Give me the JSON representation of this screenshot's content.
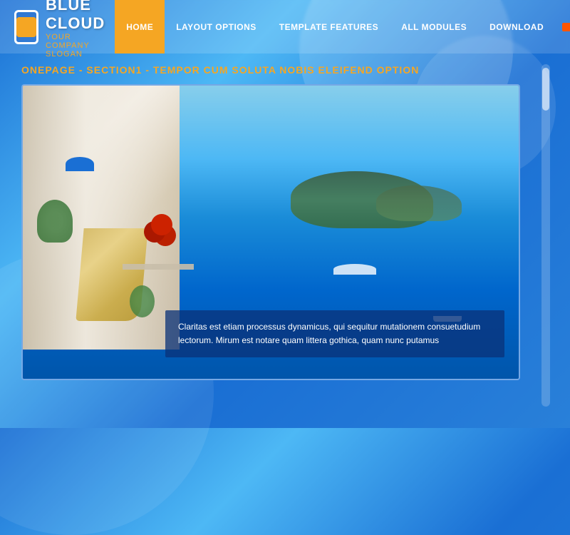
{
  "brand": {
    "name": "BLUE CLOUD",
    "slogan": "YOUR COMPANY SLOGAN",
    "logo_bg_color": "#1a6fd4",
    "logo_accent_color": "#f5a623"
  },
  "nav": {
    "items": [
      {
        "id": "home",
        "label": "HOME",
        "active": true
      },
      {
        "id": "layout-options",
        "label": "LAYOUT OPTIONS",
        "active": false
      },
      {
        "id": "template-features",
        "label": "TEMPLATE FEATURES",
        "active": false
      },
      {
        "id": "all-modules",
        "label": "ALL MODULES",
        "active": false
      },
      {
        "id": "download",
        "label": "DOWNLOAD",
        "active": false
      }
    ],
    "color_dots": [
      {
        "color": "#ff5500"
      },
      {
        "color": "#22bb22"
      },
      {
        "color": "#ff44aa"
      },
      {
        "color": "#ff0088"
      }
    ]
  },
  "section": {
    "title": "ONEPAGE - SECTION1 - TEMPOR CUM SOLUTA NOBIS ELEIFEND OPTION",
    "slideshow": {
      "caption": "Claritas est etiam processus dynamicus, qui sequitur mutationem consuetudium lectorum. Mirum est notare quam littera gothica, quam nunc putamus"
    }
  }
}
